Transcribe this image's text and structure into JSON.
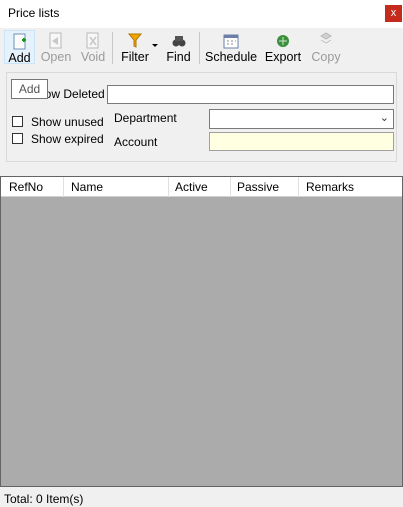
{
  "window": {
    "title": "Price lists",
    "close_label": "x"
  },
  "toolbar": {
    "add": "Add",
    "open": "Open",
    "void": "Void",
    "filter": "Filter",
    "find": "Find",
    "schedule": "Schedule",
    "export": "Export",
    "copy": "Copy"
  },
  "tooltip": {
    "text": "Add"
  },
  "filters": {
    "show_deleted": "Show Deleted",
    "show_unused": "Show unused",
    "show_expired": "Show expired",
    "department_label": "Department",
    "account_label": "Account",
    "search_value": "",
    "department_value": "",
    "account_value": ""
  },
  "grid": {
    "columns": [
      "RefNo",
      "Name",
      "Active",
      "Passive",
      "Remarks"
    ],
    "rows": []
  },
  "status": {
    "text": "Total: 0 Item(s)"
  },
  "colors": {
    "accent": "#0078d7",
    "empty_area": "#ababab",
    "highlight_field": "#ffffe1"
  }
}
